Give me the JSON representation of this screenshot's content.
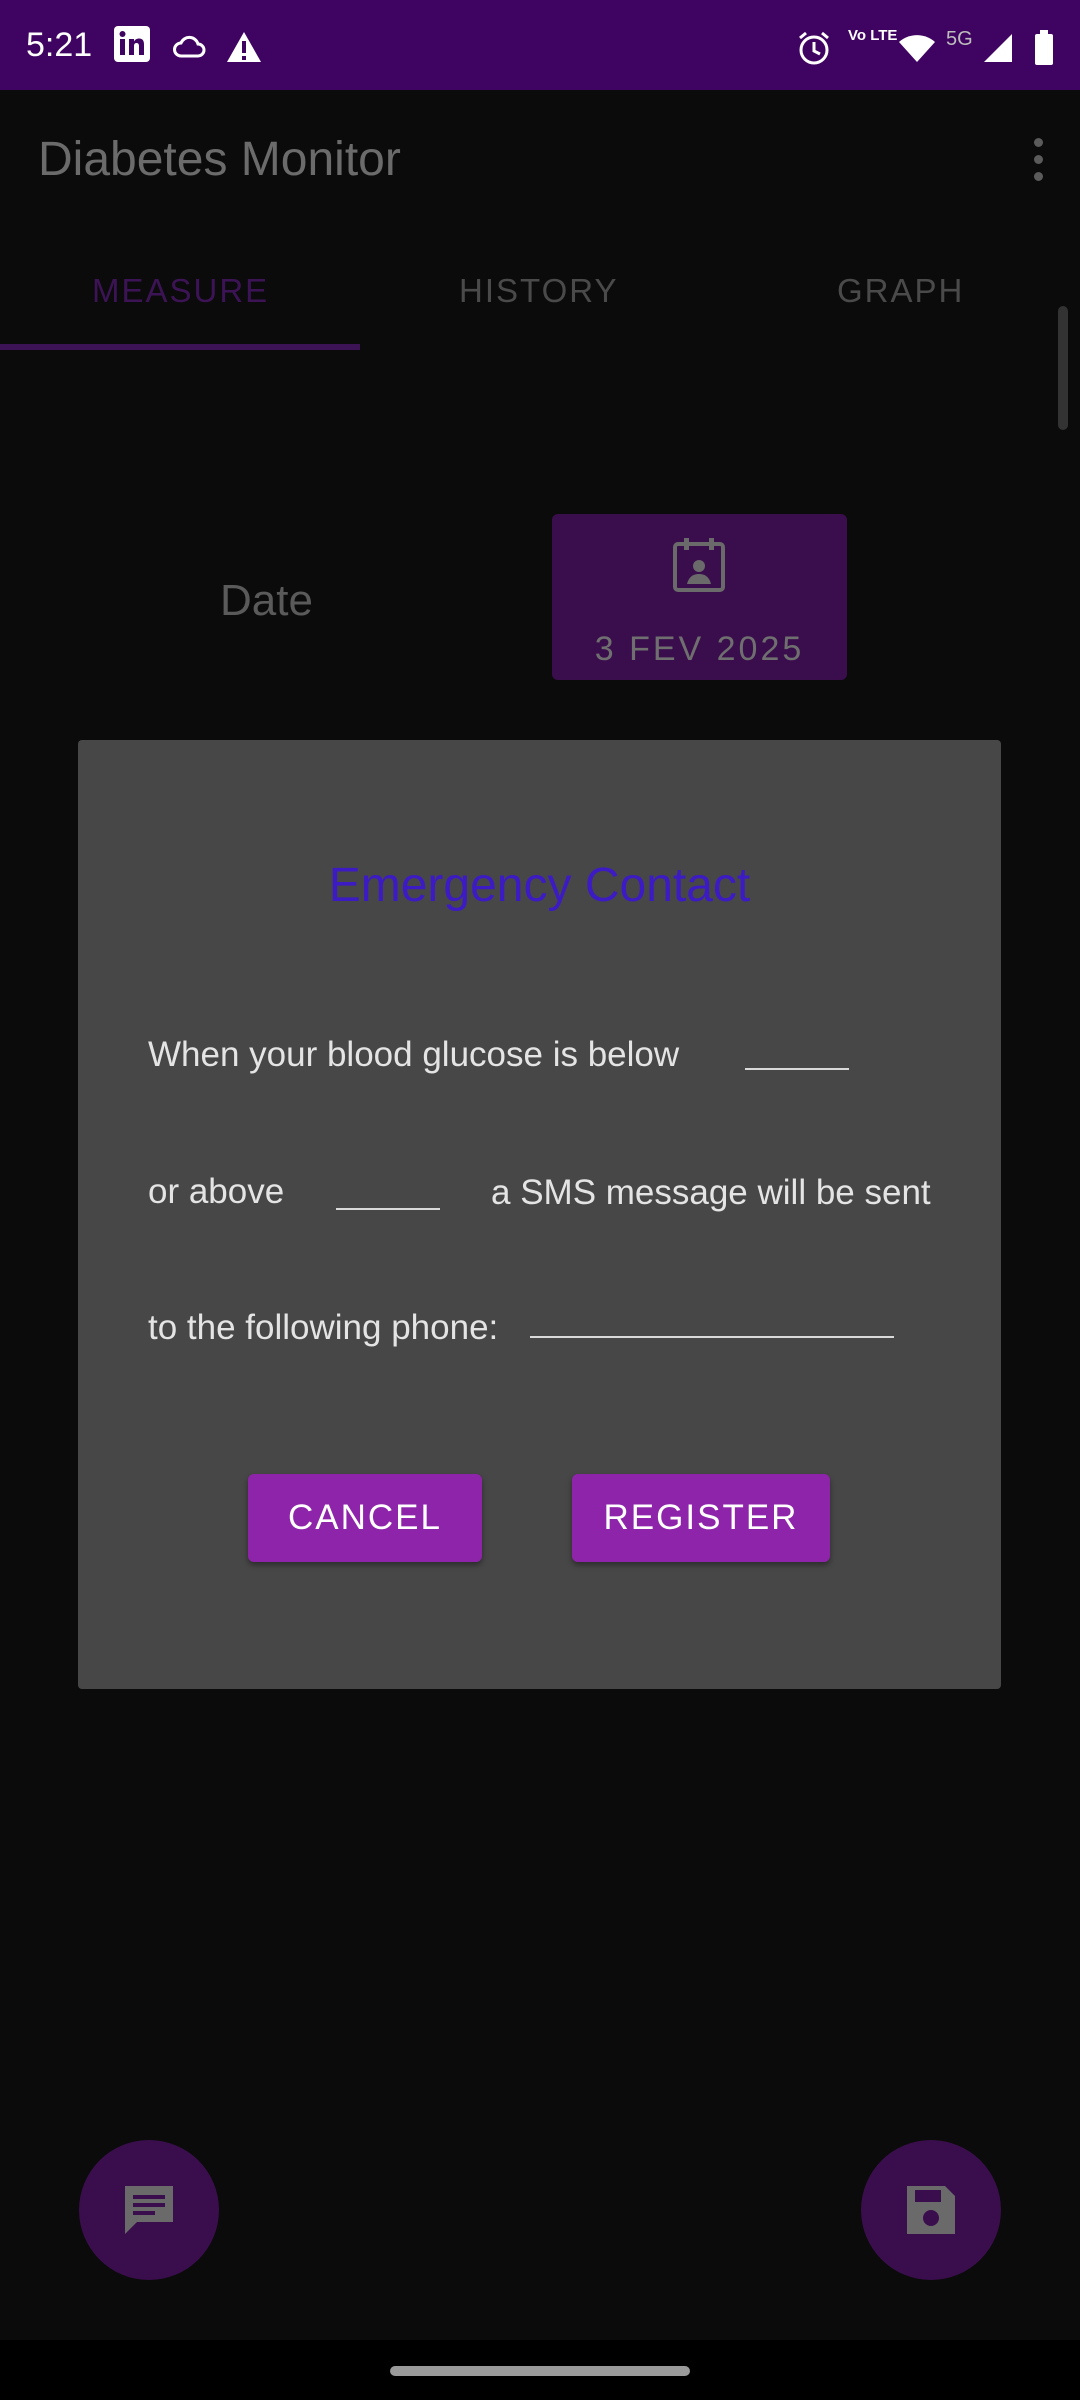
{
  "status_bar": {
    "time": "5:21",
    "left_icons": [
      "linkedin-icon",
      "cloud-icon",
      "warning-icon"
    ],
    "right_icons": [
      "alarm-icon",
      "volte-icon",
      "wifi-icon",
      "5g-icon",
      "signal-icon",
      "battery-icon"
    ],
    "network_label": "5G",
    "volte_label": "Vo LTE"
  },
  "app_bar": {
    "title": "Diabetes Monitor"
  },
  "tabs": [
    {
      "label": "MEASURE",
      "active": true
    },
    {
      "label": "HISTORY",
      "active": false
    },
    {
      "label": "GRAPH",
      "active": false
    }
  ],
  "measure": {
    "date_label": "Date",
    "date_value": "3 FEV 2025"
  },
  "dialog": {
    "title": "Emergency Contact",
    "line1_text": "When your blood glucose is below",
    "line2_prefix": "or above",
    "line2_suffix": "a SMS message will be sent",
    "line3_text": "to the following phone:",
    "below_value": "",
    "above_value": "",
    "phone_value": "",
    "cancel_label": "CANCEL",
    "register_label": "REGISTER"
  },
  "colors": {
    "status_bar": "#3f0461",
    "accent": "#8e24aa",
    "dialog_bg": "#474747",
    "dialog_title": "#3d1bc4"
  }
}
